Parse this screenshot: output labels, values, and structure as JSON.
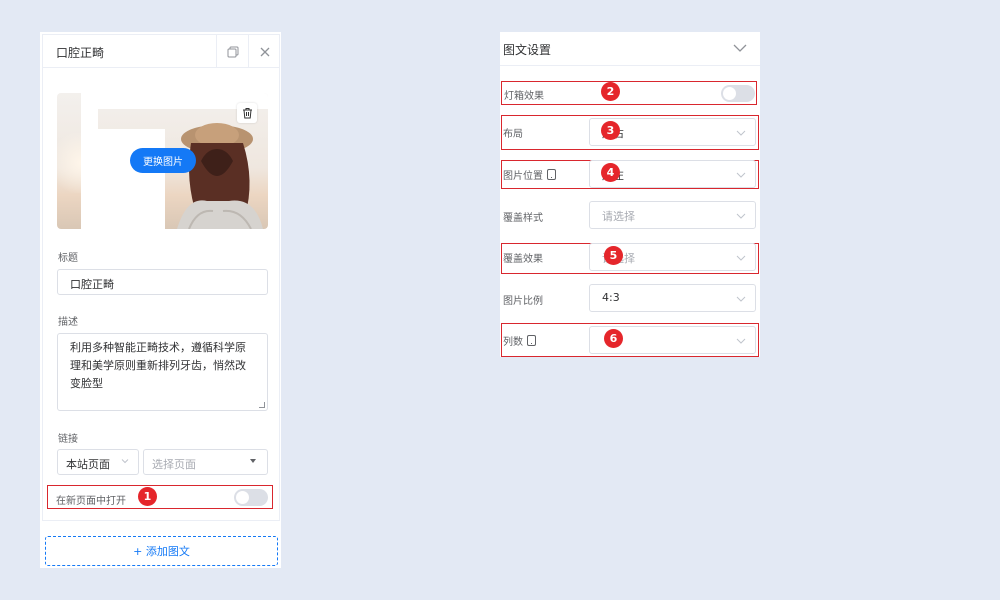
{
  "editor": {
    "card_title": "口腔正畸",
    "replace_image_label": "更换图片",
    "title_label": "标题",
    "title_value": "口腔正畸",
    "desc_label": "描述",
    "desc_value": "利用多种智能正畸技术，遵循科学原理和美学原则重新排列牙齿，悄然改变脸型",
    "link_label": "链接",
    "link_type": "本站页面",
    "link_page_placeholder": "选择页面",
    "open_new_label": "在新页面中打开",
    "open_new_on": false,
    "add_label": "+ 添加图文"
  },
  "settings": {
    "title": "图文设置",
    "rows": {
      "dark_effect": {
        "label": "灯箱效果",
        "on": false
      },
      "layout": {
        "label": "布局",
        "value": "居右"
      },
      "image_pos": {
        "label": "图片位置",
        "value": "居左"
      },
      "cover_style": {
        "label": "覆盖样式",
        "placeholder": "请选择"
      },
      "cover_effect": {
        "label": "覆盖效果",
        "placeholder": "请选择"
      },
      "ratio": {
        "label": "图片比例",
        "value": "4:3"
      },
      "columns": {
        "label": "列数",
        "value": ""
      }
    }
  },
  "badges": [
    "1",
    "2",
    "3",
    "4",
    "5",
    "6"
  ],
  "colors": {
    "accent": "#1479f6",
    "highlight": "#d9272e",
    "badge": "#e5262b",
    "background": "#e3e9f4"
  }
}
